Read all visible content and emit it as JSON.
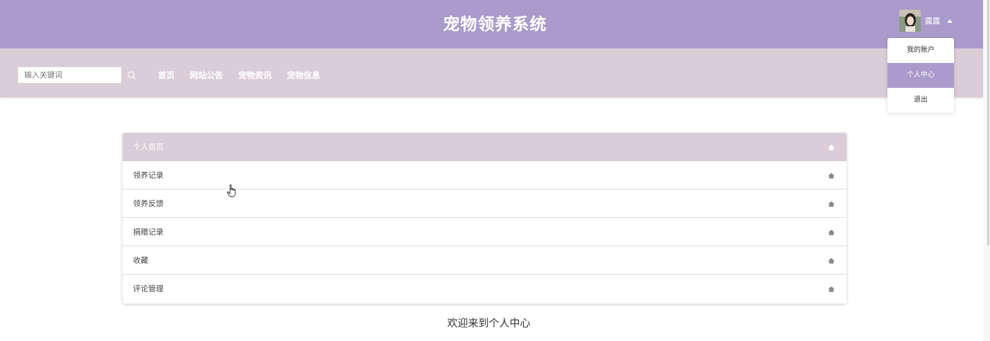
{
  "header": {
    "title": "宠物领养系统",
    "user": {
      "name": "露露",
      "avatar_icon": "user-avatar-photo"
    }
  },
  "nav": {
    "search_placeholder": "输入关键词",
    "links": [
      "首页",
      "网站公告",
      "宠物资讯",
      "宠物信息"
    ]
  },
  "dropdown": {
    "items": [
      "我的账户",
      "个人中心",
      "退出"
    ],
    "active_index": 1
  },
  "menu": {
    "items": [
      "个人首页",
      "领养记录",
      "领养反馈",
      "捐赠记录",
      "收藏",
      "评论管理"
    ],
    "active_index": 0,
    "item_icon": "home-icon"
  },
  "main": {
    "welcome": "欢迎来到个人中心"
  },
  "colors": {
    "header_bg": "#a99bcb",
    "nav_bg": "#dbcdd8",
    "accent": "#a99bcb"
  }
}
